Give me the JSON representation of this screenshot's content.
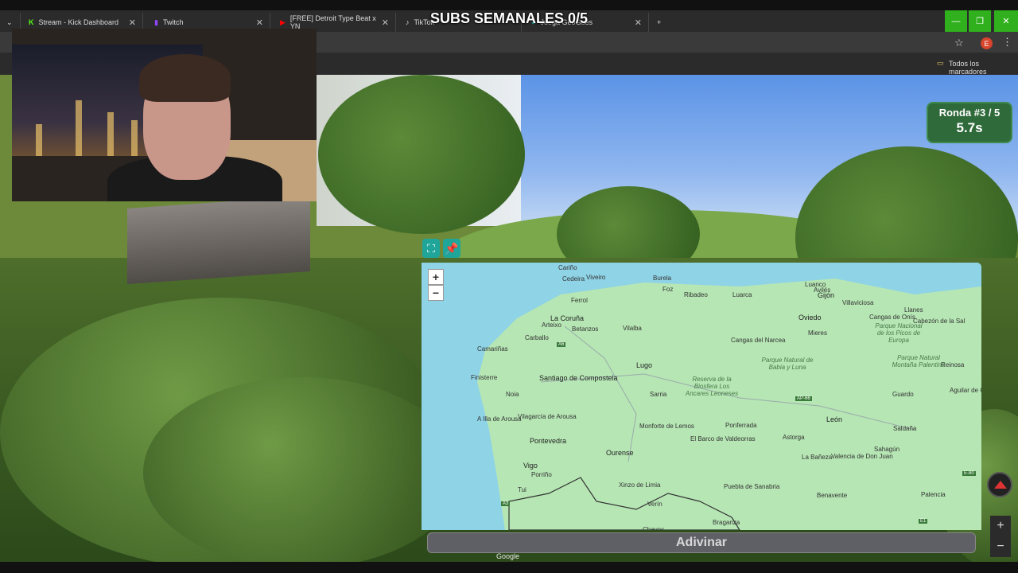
{
  "browser": {
    "tabs": [
      {
        "label": "Stream - Kick Dashboard",
        "icon": "kick-icon",
        "color": "#53fc18"
      },
      {
        "label": "Twitch",
        "icon": "twitch-icon",
        "color": "#9146ff"
      },
      {
        "label": "[FREE] Detroit Type Beat x YN",
        "icon": "youtube-icon",
        "color": "#ff0000"
      },
      {
        "label": "TikTok",
        "icon": "tiktok-icon",
        "color": "#ffffff"
      },
      {
        "label": "Juega GeoGues",
        "icon": "geoguessr-icon",
        "color": "#1fa59a"
      }
    ],
    "new_tab": "+",
    "bookmarks_label": "Todos los marcadores",
    "profile_initial": "E"
  },
  "overlay": {
    "subs_text": "SUBS SEMANALES 0/5"
  },
  "game": {
    "round_label": "Ronda #3 / 5",
    "timer": "5.7s",
    "guess_button": "Adivinar",
    "map_zoom_in": "+",
    "map_zoom_out": "−",
    "pano_zoom_in": "+",
    "pano_zoom_out": "−",
    "google_watermark": "Google"
  },
  "map": {
    "places": [
      {
        "name": "Cariño"
      },
      {
        "name": "Cedeira"
      },
      {
        "name": "Viveiro"
      },
      {
        "name": "Burela"
      },
      {
        "name": "Foz"
      },
      {
        "name": "Ferrol"
      },
      {
        "name": "Ribadeo"
      },
      {
        "name": "Luarca"
      },
      {
        "name": "Luanco"
      },
      {
        "name": "Avilés"
      },
      {
        "name": "Gijón"
      },
      {
        "name": "Villaviciosa"
      },
      {
        "name": "Llanes"
      },
      {
        "name": "La Coruña"
      },
      {
        "name": "Arteixo"
      },
      {
        "name": "Betanzos"
      },
      {
        "name": "Vilalba"
      },
      {
        "name": "Oviedo"
      },
      {
        "name": "Mieres"
      },
      {
        "name": "Cangas de Onís"
      },
      {
        "name": "Cabezón de la Sal"
      },
      {
        "name": "Carballo"
      },
      {
        "name": "Camariñas"
      },
      {
        "name": "Cangas del Narcea"
      },
      {
        "name": "Lugo"
      },
      {
        "name": "Santiago de Compostela"
      },
      {
        "name": "Finisterre"
      },
      {
        "name": "Noia"
      },
      {
        "name": "Sarria"
      },
      {
        "name": "Guardo"
      },
      {
        "name": "Reinosa"
      },
      {
        "name": "Aguilar de Campoo"
      },
      {
        "name": "A Illa de Arousa"
      },
      {
        "name": "Vilagarcía de Arousa"
      },
      {
        "name": "Pontevedra"
      },
      {
        "name": "Monforte de Lemos"
      },
      {
        "name": "Ponferrada"
      },
      {
        "name": "León"
      },
      {
        "name": "El Barco de Valdeorras"
      },
      {
        "name": "Astorga"
      },
      {
        "name": "Saldaña"
      },
      {
        "name": "Sahagún"
      },
      {
        "name": "Ourense"
      },
      {
        "name": "Vigo"
      },
      {
        "name": "La Bañeza"
      },
      {
        "name": "Valencia de Don Juan"
      },
      {
        "name": "Porriño"
      },
      {
        "name": "Xinzo de Limia"
      },
      {
        "name": "Puebla de Sanabria"
      },
      {
        "name": "Benavente"
      },
      {
        "name": "Palencia"
      },
      {
        "name": "Tui"
      },
      {
        "name": "Verín"
      },
      {
        "name": "Braganza"
      },
      {
        "name": "Chaves"
      }
    ],
    "parks": [
      "Parque Nacional de los Picos de Europa",
      "Parque Natural Montaña Palentina",
      "Parque Natural de Babia y Luna",
      "Reserva de la Biosfera Los Ancares Leoneses"
    ],
    "roads": [
      "A3",
      "A6",
      "AP-66",
      "E-80",
      "E1"
    ]
  }
}
